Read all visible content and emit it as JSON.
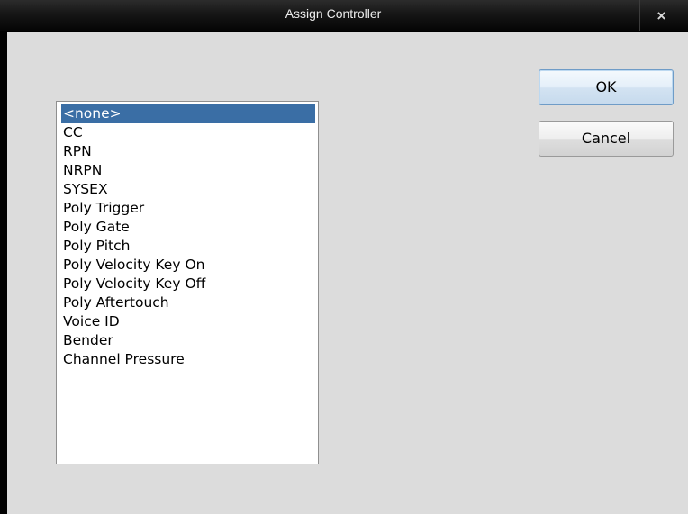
{
  "window": {
    "title": "Assign Controller",
    "close_glyph": "×"
  },
  "controller_list": {
    "selected_index": 0,
    "items": [
      "<none>",
      "CC",
      "RPN",
      "NRPN",
      "SYSEX",
      "Poly Trigger",
      "Poly Gate",
      "Poly Pitch",
      "Poly Velocity Key On",
      "Poly Velocity Key Off",
      "Poly Aftertouch",
      "Voice ID",
      "Bender",
      "Channel Pressure"
    ]
  },
  "buttons": {
    "ok_label": "OK",
    "cancel_label": "Cancel"
  },
  "colors": {
    "titlebar": "#161616",
    "dialog_background": "#dcdcdc",
    "selection": "#3a6ea5",
    "selection_text": "#ffffff"
  },
  "icons": {
    "close": "close-icon"
  }
}
